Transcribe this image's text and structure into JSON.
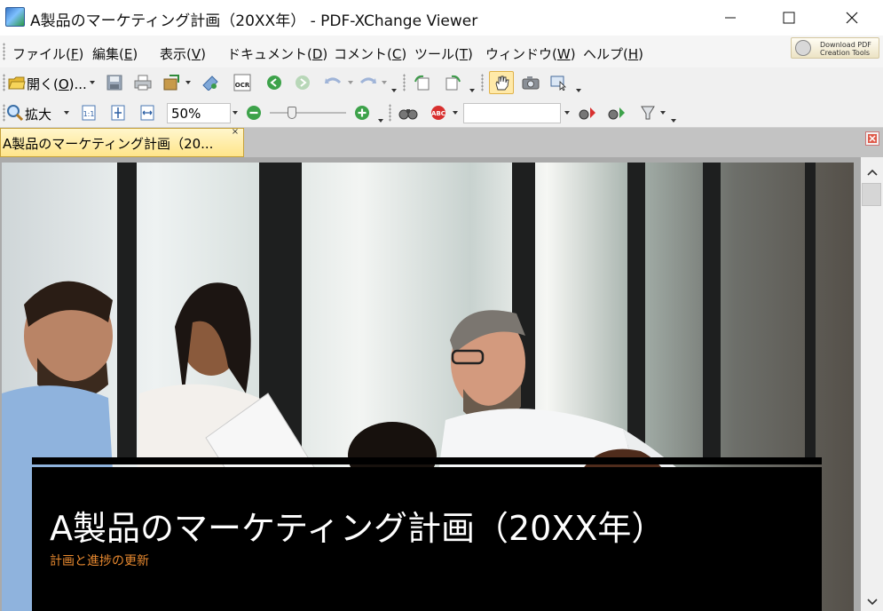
{
  "window": {
    "title": "A製品のマーケティング計画（20XX年） - PDF-XChange Viewer"
  },
  "menu": {
    "items": [
      {
        "label": "ファイル(",
        "key": "F",
        "suffix": ")"
      },
      {
        "label": "編集(",
        "key": "E",
        "suffix": ")"
      },
      {
        "label": "表示(",
        "key": "V",
        "suffix": ")"
      },
      {
        "label": "ドキュメント(",
        "key": "D",
        "suffix": ")"
      },
      {
        "label": "コメント(",
        "key": "C",
        "suffix": ")"
      },
      {
        "label": "ツール(",
        "key": "T",
        "suffix": ")"
      },
      {
        "label": "ウィンドウ(",
        "key": "W",
        "suffix": ")"
      },
      {
        "label": "ヘルプ(",
        "key": "H",
        "suffix": ")"
      }
    ],
    "download_line1": "Download PDF",
    "download_line2": "Creation Tools"
  },
  "toolbar1": {
    "open_label": "開く(",
    "open_key": "O",
    "open_suffix": ")...",
    "ocr_label": "OCR"
  },
  "toolbar2": {
    "zoom_tool_label": "拡大",
    "zoom_value": "50%"
  },
  "tabs": {
    "document_tab": "A製品のマーケティング計画（20..."
  },
  "document": {
    "title": "A製品のマーケティング計画（20XX年）",
    "subtitle": "計画と進捗の更新"
  },
  "colors": {
    "tab_active": "#ffe58a",
    "subtitle_accent": "#e8892f",
    "banner_bg": "#000000"
  }
}
